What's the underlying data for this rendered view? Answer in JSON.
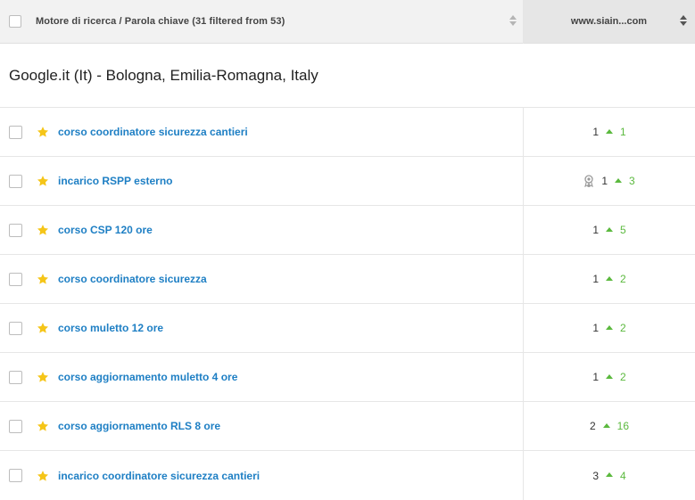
{
  "header": {
    "column_label": "Motore di ricerca / Parola chiave (31 filtered from 53)",
    "domain": "www.siain...com"
  },
  "group": {
    "title": "Google.it (It) - Bologna, Emilia-Romagna, Italy"
  },
  "colors": {
    "link": "#1e7fc4",
    "star": "#f5c518",
    "up": "#5bb93e",
    "header_bg": "#f2f2f2",
    "header_active_bg": "#e6e6e6"
  },
  "rows": [
    {
      "keyword": "corso coordinatore sicurezza cantieri",
      "rank": "1",
      "change": "1",
      "award": false,
      "icon": "star-icon"
    },
    {
      "keyword": "incarico RSPP esterno",
      "rank": "1",
      "change": "3",
      "award": true,
      "icon": "star-icon"
    },
    {
      "keyword": "corso CSP 120 ore",
      "rank": "1",
      "change": "5",
      "award": false,
      "icon": "star-icon"
    },
    {
      "keyword": "corso coordinatore sicurezza",
      "rank": "1",
      "change": "2",
      "award": false,
      "icon": "star-icon"
    },
    {
      "keyword": "corso muletto 12 ore",
      "rank": "1",
      "change": "2",
      "award": false,
      "icon": "star-icon"
    },
    {
      "keyword": "corso aggiornamento muletto 4 ore",
      "rank": "1",
      "change": "2",
      "award": false,
      "icon": "star-icon"
    },
    {
      "keyword": "corso aggiornamento RLS 8 ore",
      "rank": "2",
      "change": "16",
      "award": false,
      "icon": "star-icon"
    },
    {
      "keyword": "incarico coordinatore sicurezza cantieri",
      "rank": "3",
      "change": "4",
      "award": false,
      "icon": "star-icon"
    }
  ]
}
